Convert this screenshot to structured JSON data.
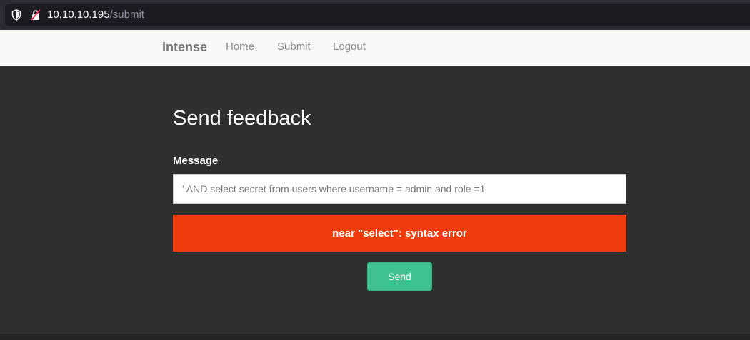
{
  "browser": {
    "url_host": "10.10.10.195",
    "url_path": "/submit",
    "icons": [
      "shield-icon",
      "insecure-lock-icon"
    ]
  },
  "navbar": {
    "brand": "Intense",
    "links": [
      {
        "label": "Home"
      },
      {
        "label": "Submit"
      },
      {
        "label": "Logout"
      }
    ]
  },
  "form": {
    "title": "Send feedback",
    "message_label": "Message",
    "message_value": "' AND select secret from users where username = admin and role =1",
    "error_text": "near \"select\": syntax error",
    "send_label": "Send"
  },
  "colors": {
    "error": "#ef3c0c",
    "accent": "#3fc28f",
    "background": "#2f2f2f"
  }
}
